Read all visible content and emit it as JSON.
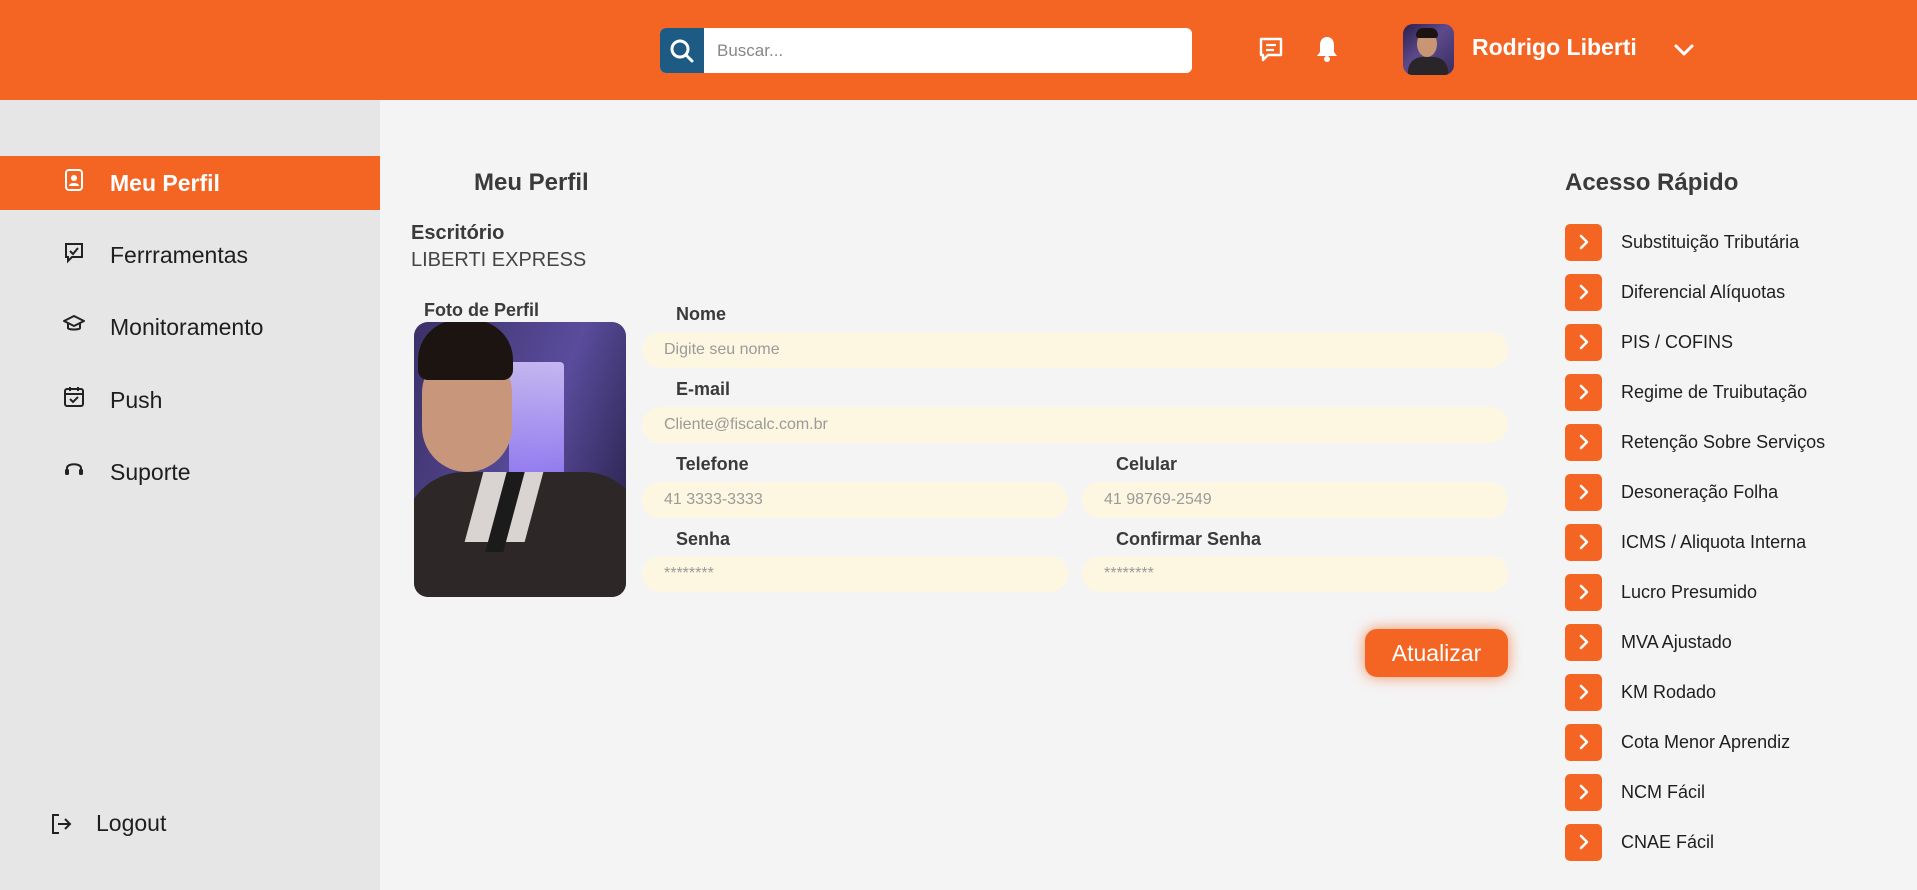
{
  "colors": {
    "accent": "#f46524",
    "search_button": "#1d5b84",
    "field_bg": "#fdf6e0",
    "sidebar_bg": "#e6e6e6"
  },
  "header": {
    "search": {
      "placeholder": "Buscar...",
      "icon": "search-icon"
    },
    "icons": [
      "message-icon",
      "bell-icon"
    ],
    "user": {
      "name": "Rodrigo Liberti",
      "dropdown_icon": "chevron-down-icon"
    }
  },
  "sidebar": {
    "items": [
      {
        "label": "Meu Perfil",
        "icon": "profile-badge-icon",
        "active": true
      },
      {
        "label": "Ferrramentas",
        "icon": "tools-icon",
        "active": false
      },
      {
        "label": "Monitoramento",
        "icon": "monitor-icon",
        "active": false
      },
      {
        "label": "Push",
        "icon": "calendar-check-icon",
        "active": false
      },
      {
        "label": "Suporte",
        "icon": "headset-icon",
        "active": false
      }
    ],
    "logout": {
      "label": "Logout",
      "icon": "logout-icon"
    }
  },
  "profile": {
    "title": "Meu Perfil",
    "office_label": "Escritório",
    "office_value": "LIBERTI EXPRESS",
    "photo_label": "Foto de Perfil",
    "fields": {
      "name": {
        "label": "Nome",
        "placeholder": "Digite seu nome"
      },
      "email": {
        "label": "E-mail",
        "placeholder": "Cliente@fiscalc.com.br"
      },
      "phone": {
        "label": "Telefone",
        "placeholder": "41 3333-3333"
      },
      "mobile": {
        "label": "Celular",
        "placeholder": "41 98769-2549"
      },
      "password": {
        "label": "Senha",
        "placeholder": "********"
      },
      "confirm_password": {
        "label": "Confirmar Senha",
        "placeholder": "********"
      }
    },
    "update_button": "Atualizar"
  },
  "quick_access": {
    "title": "Acesso Rápido",
    "items": [
      "Substituição Tributária",
      "Diferencial Alíquotas",
      "PIS / COFINS",
      "Regime de Truibutação",
      "Retenção Sobre Serviços",
      "Desoneração Folha",
      "ICMS / Aliquota Interna",
      "Lucro Presumido",
      "MVA Ajustado",
      "KM Rodado",
      "Cota Menor Aprendiz",
      "NCM Fácil",
      "CNAE Fácil"
    ]
  }
}
